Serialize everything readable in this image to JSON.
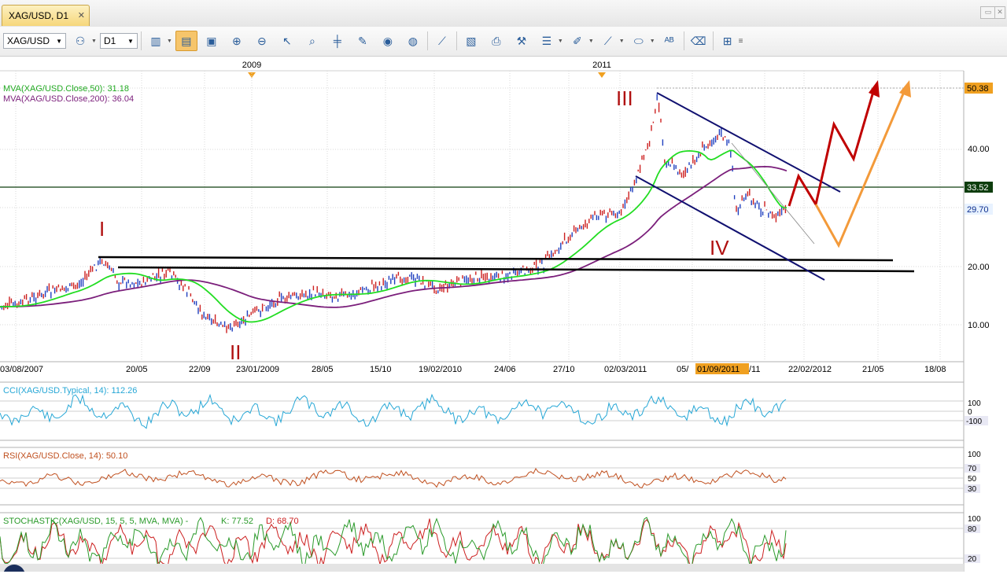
{
  "tab": {
    "title": "XAG/USD, D1",
    "close": "✕"
  },
  "toolbar": {
    "symbol": "XAG/USD",
    "timeframe": "D1",
    "buttons": [
      "bar-chart-icon",
      "template-icon",
      "zoom-in-icon",
      "zoom-out-icon",
      "cursor-icon",
      "zoom-area-icon",
      "crosshair-icon",
      "note-icon",
      "eye-icon",
      "globe-icon",
      "ruler-icon",
      "screenshot-icon",
      "print-icon",
      "tools-icon",
      "lines-icon",
      "pen-icon",
      "brush-icon",
      "ellipse-icon",
      "text-icon",
      "eraser-icon",
      "tree-icon"
    ]
  },
  "top_axis": {
    "labels": [
      "2009",
      "2011"
    ]
  },
  "indicators_main": [
    {
      "label": "MVA(XAG/USD.Close,50): 31.18",
      "color": "#22aa22"
    },
    {
      "label": "MVA(XAG/USD.Close,200): 36.04",
      "color": "#7b1f7b"
    }
  ],
  "price_axis": {
    "ticks": [
      "40.00",
      "20.00",
      "10.00"
    ],
    "current_high": "50.38",
    "level_line": "33.52",
    "last_price": "29.70"
  },
  "waves": [
    "I",
    "II",
    "III",
    "IV"
  ],
  "date_axis": {
    "labels": [
      "03/08/2007",
      "20/05",
      "22/09",
      "23/01/2009",
      "28/05",
      "15/10",
      "19/02/2010",
      "24/06",
      "27/10",
      "02/03/2011",
      "05/",
      "/11",
      "22/02/2012",
      "21/05",
      "18/08"
    ],
    "highlight": "01/09/2011"
  },
  "cci": {
    "label": "CCI(XAG/USD.Typical, 14): 112.26",
    "ticks": [
      "100",
      "0",
      "-100"
    ]
  },
  "rsi": {
    "label": "RSI(XAG/USD.Close, 14): 50.10",
    "ticks": [
      "100",
      "70",
      "50",
      "30"
    ]
  },
  "stoch": {
    "label": "STOCHASTIC(XAG/USD, 15, 5, 5, MVA, MVA) -",
    "k": "K: 77.52",
    "d": "D: 68.70",
    "ticks": [
      "100",
      "80",
      "20"
    ]
  },
  "colors": {
    "bull": "#1f3fbf",
    "bear": "#cc1f1f",
    "mva50": "#22dd22",
    "mva200": "#7b1f7b",
    "channel": "#101070",
    "projection_red": "#c00000",
    "projection_orange": "#f39a3a"
  }
}
